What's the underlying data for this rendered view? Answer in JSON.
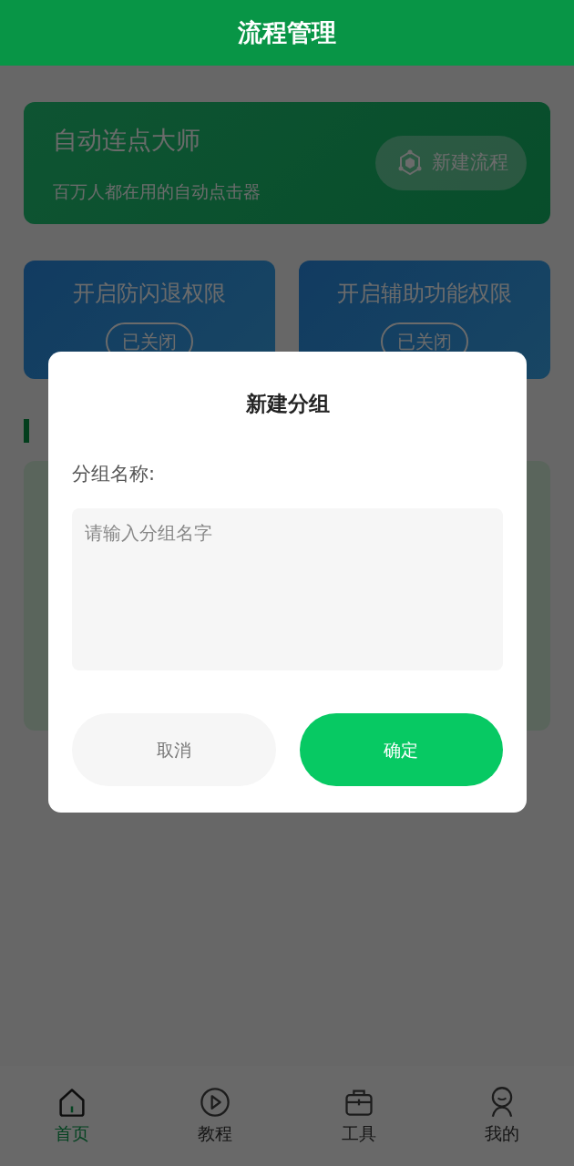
{
  "header": {
    "title": "流程管理"
  },
  "banner": {
    "title": "自动连点大师",
    "subtitle": "百万人都在用的自动点击器",
    "button": "新建流程"
  },
  "permissions": [
    {
      "title": "开启防闪退权限",
      "status": "已关闭"
    },
    {
      "title": "开启辅助功能权限",
      "status": "已关闭"
    }
  ],
  "dialog": {
    "title": "新建分组",
    "label": "分组名称:",
    "placeholder": "请输入分组名字",
    "buttons": [
      {
        "label": "取消",
        "kind": "cancel"
      },
      {
        "label": "确定",
        "kind": "confirm"
      }
    ]
  },
  "tabs": [
    {
      "label": "首页",
      "kind": "home",
      "selected": true
    },
    {
      "label": "教程",
      "kind": "play",
      "selected": false
    },
    {
      "label": "工具",
      "kind": "toolbox",
      "selected": false
    },
    {
      "label": "我的",
      "kind": "person",
      "selected": false
    }
  ]
}
